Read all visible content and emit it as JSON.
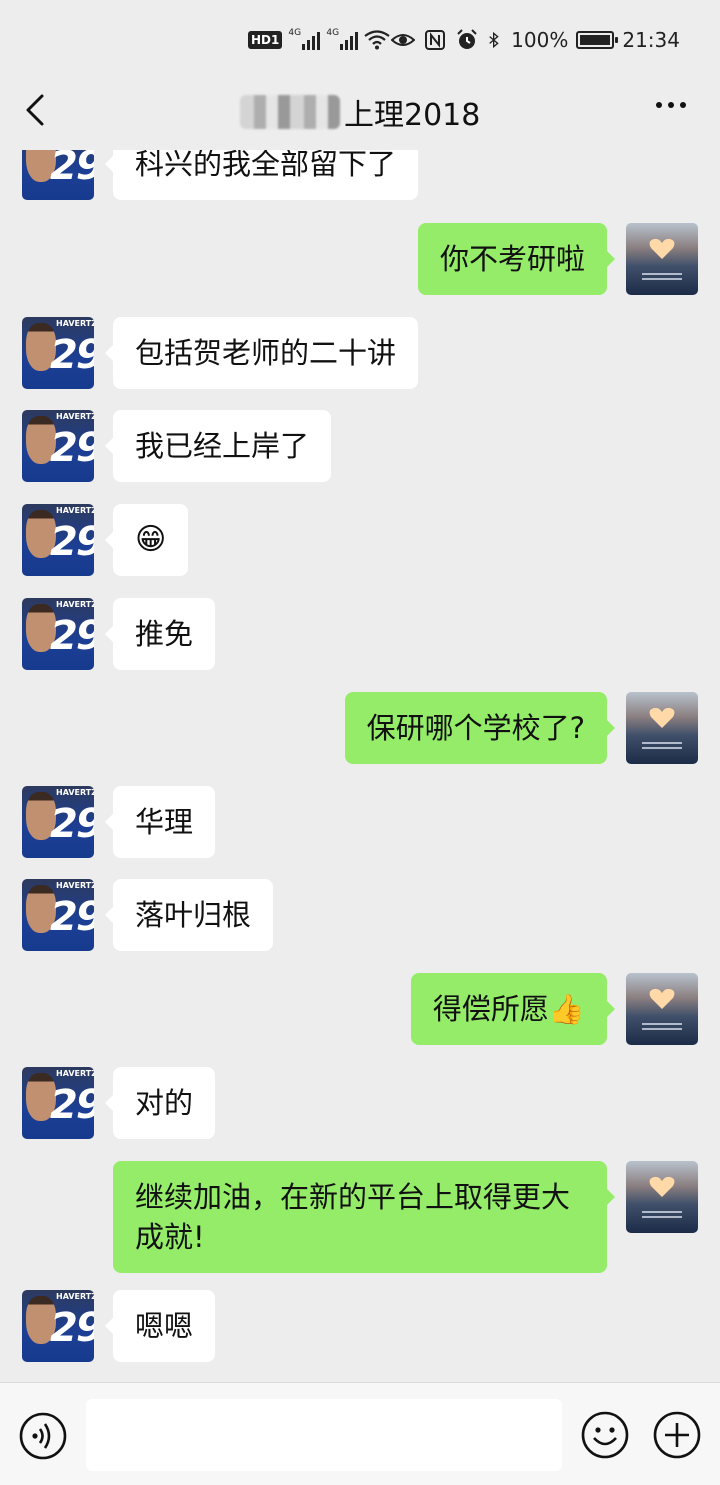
{
  "status_bar": {
    "hd_label": "HD",
    "sim1_label": "1",
    "net1": "4G",
    "net2": "4G",
    "battery": "100%",
    "time": "21:34"
  },
  "header": {
    "title_visible": "上理2018"
  },
  "messages": [
    {
      "side": "in",
      "text": "科兴的我全部留下了"
    },
    {
      "side": "out",
      "text": "你不考研啦"
    },
    {
      "side": "in",
      "text": "包括贺老师的二十讲"
    },
    {
      "side": "in",
      "text": "我已经上岸了"
    },
    {
      "side": "in",
      "text": "😁"
    },
    {
      "side": "in",
      "text": "推免"
    },
    {
      "side": "out",
      "text": "保研哪个学校了?"
    },
    {
      "side": "in",
      "text": "华理"
    },
    {
      "side": "in",
      "text": "落叶归根"
    },
    {
      "side": "out",
      "text": "得偿所愿👍"
    },
    {
      "side": "in",
      "text": "对的"
    },
    {
      "side": "out",
      "text": "继续加油，在新的平台上取得更大成就!"
    },
    {
      "side": "in",
      "text": "嗯嗯"
    }
  ],
  "avatars": {
    "incoming_jersey_text": "HAVERTZ",
    "incoming_jersey_number": "29"
  },
  "input_bar": {
    "placeholder": ""
  },
  "colors": {
    "background": "#ededed",
    "outgoing_bubble": "#95ec69",
    "incoming_bubble": "#ffffff"
  }
}
